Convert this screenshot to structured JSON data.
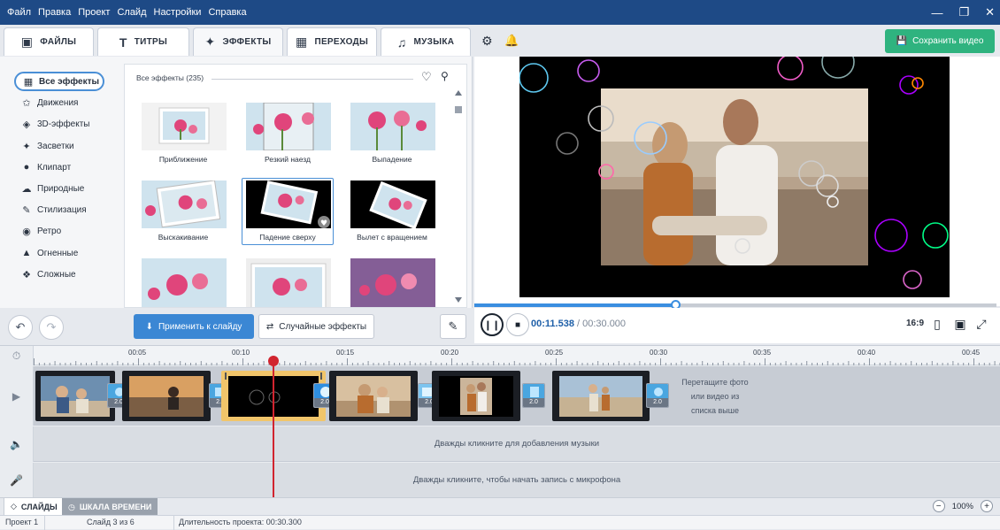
{
  "menu": [
    "Файл",
    "Правка",
    "Проект",
    "Слайд",
    "Настройки",
    "Справка"
  ],
  "window_controls": [
    "minimize-icon",
    "maximize-icon",
    "close-icon"
  ],
  "tabs": [
    {
      "label": "ФАЙЛЫ",
      "icon": "add-file-icon",
      "active": false
    },
    {
      "label": "ТИТРЫ",
      "icon": "text-icon",
      "active": false
    },
    {
      "label": "ЭФФЕКТЫ",
      "icon": "effects-icon",
      "active": true
    },
    {
      "label": "ПЕРЕХОДЫ",
      "icon": "transitions-icon",
      "active": false
    },
    {
      "label": "МУЗЫКА",
      "icon": "music-icon",
      "active": false
    }
  ],
  "save_button": "Сохранить видео",
  "categories": [
    {
      "label": "Все эффекты",
      "icon": "grid-icon",
      "selected": true
    },
    {
      "label": "Движения",
      "icon": "motion-icon"
    },
    {
      "label": "3D-эффекты",
      "icon": "cube-icon"
    },
    {
      "label": "Засветки",
      "icon": "sparkle-icon"
    },
    {
      "label": "Клипарт",
      "icon": "pin-icon"
    },
    {
      "label": "Природные",
      "icon": "cloud-icon"
    },
    {
      "label": "Стилизация",
      "icon": "brush-icon"
    },
    {
      "label": "Ретро",
      "icon": "camera-icon"
    },
    {
      "label": "Огненные",
      "icon": "fire-icon"
    },
    {
      "label": "Сложные",
      "icon": "puzzle-icon"
    }
  ],
  "effects_header": "Все эффекты (235)",
  "effects": [
    {
      "label": "Приближение"
    },
    {
      "label": "Резкий наезд"
    },
    {
      "label": "Выпадение"
    },
    {
      "label": "Выскакивание"
    },
    {
      "label": "Падение сверху",
      "selected": true
    },
    {
      "label": "Вылет с вращением"
    },
    {
      "label": ""
    },
    {
      "label": ""
    },
    {
      "label": ""
    }
  ],
  "apply_button": "Применить к слайду",
  "random_button": "Случайные эффекты",
  "player": {
    "current_time": "00:11.538",
    "separator": " / ",
    "total_time": "00:30.000",
    "aspect": "16:9",
    "progress": 0.385
  },
  "ruler_labels": [
    "00:05",
    "00:10",
    "00:15",
    "00:20",
    "00:25",
    "00:30",
    "00:35",
    "00:40",
    "00:45"
  ],
  "transitions": [
    "2.0",
    "2.0",
    "2.0",
    "2.0",
    "2.0",
    "2.0"
  ],
  "drop_hint": "Перетащите фото или видео из списка выше",
  "music_lane": "Дважды кликните для добавления музыки",
  "mic_lane": "Дважды кликните, чтобы начать запись с микрофона",
  "bottom_tabs": [
    "СЛАЙДЫ",
    "ШКАЛА ВРЕМЕНИ"
  ],
  "zoom": "100%",
  "status": {
    "project": "Проект 1",
    "slide": "Слайд 3 из 6",
    "duration": "Длительность проекта: 00:30.300"
  },
  "colors": {
    "titlebar": "#1e4a86",
    "accent": "#3b87d4",
    "save": "#2fb37f",
    "playhead": "#d1242f",
    "selected_clip": "#f1c56a"
  }
}
